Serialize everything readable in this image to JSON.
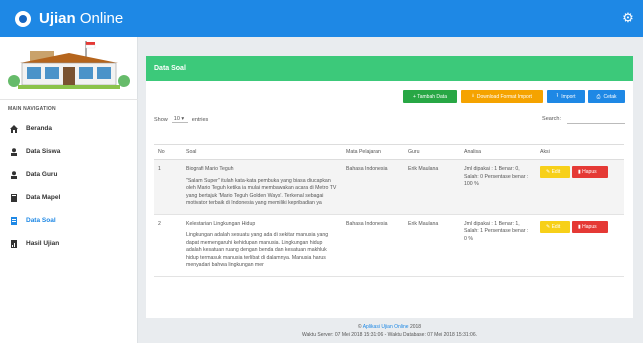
{
  "app": {
    "title_bold": "Ujian",
    "title_rest": "Online"
  },
  "sidebar": {
    "header": "MAIN NAVIGATION",
    "items": [
      {
        "label": "Beranda",
        "icon": "home-icon"
      },
      {
        "label": "Data Siswa",
        "icon": "user-icon"
      },
      {
        "label": "Data Guru",
        "icon": "user-icon"
      },
      {
        "label": "Data Mapel",
        "icon": "book-icon"
      },
      {
        "label": "Data Soal",
        "icon": "document-icon",
        "active": true
      },
      {
        "label": "Hasil Ujian",
        "icon": "report-icon"
      }
    ]
  },
  "panel": {
    "title": "Data Soal"
  },
  "toolbar": {
    "tambah": "+ Tambah Data",
    "download": "Download Format Import",
    "import": "Import",
    "cetak": "Cetak"
  },
  "table_controls": {
    "show": "Show",
    "entries_value": "10",
    "entries": "entries",
    "search": "Search:"
  },
  "table": {
    "headers": [
      "No",
      "Soal",
      "Mata Pelajaran",
      "Guru",
      "Analisa",
      "Aksi"
    ],
    "rows": [
      {
        "no": "1",
        "title": "Biografi Mario Teguh",
        "body": "\"Salam Super\" itulah kata-kata pembuka yang biasa diucapkan oleh Mario Teguh ketika ia mulai membawakan acara di Metro TV yang bertajuk 'Mario Teguh Golden Ways'. Terkenal sebagai motivator terbaik di Indonesia yang memiliki kepribadian ya",
        "mapel": "Bahasa Indonesia",
        "guru": "Erik Maulana",
        "analisa": "Jml dipakai : 1 Benar: 0, Salah: 0 Persentase benar : 100 %"
      },
      {
        "no": "2",
        "title": "Kelestarian Lingkungan Hidup",
        "body": "Lingkungan adalah sesuatu yang ada di sekitar manusia yang dapat memengaruhi kehidupan manusia. Lingkungan hidup adalah kesatuan ruang dengan benda dan kesatuan makhluk hidup termasuk manusia terlibat di dalamnya. Manusia harus menyadari bahwa lingkungan mer",
        "mapel": "Bahasa Indonesia",
        "guru": "Erik Maulana",
        "analisa": "Jml dipakai : 1 Benar: 1, Salah: 1 Persentase benar : 0 %"
      }
    ],
    "edit": "Edit",
    "hapus": "Hapus"
  },
  "footer": {
    "copy": "©",
    "app_link": "Aplikasi Ujian Online",
    "year": "2018",
    "server_time": "Waktu Server: 07 Mei 2018 15:31:06 - Waktu Database: 07 Mei 2018 15:31:06."
  },
  "colors": {
    "topbar": "#1e88e5",
    "panel_head": "#3cc97a",
    "edit": "#f7d019",
    "hapus": "#e53935"
  }
}
